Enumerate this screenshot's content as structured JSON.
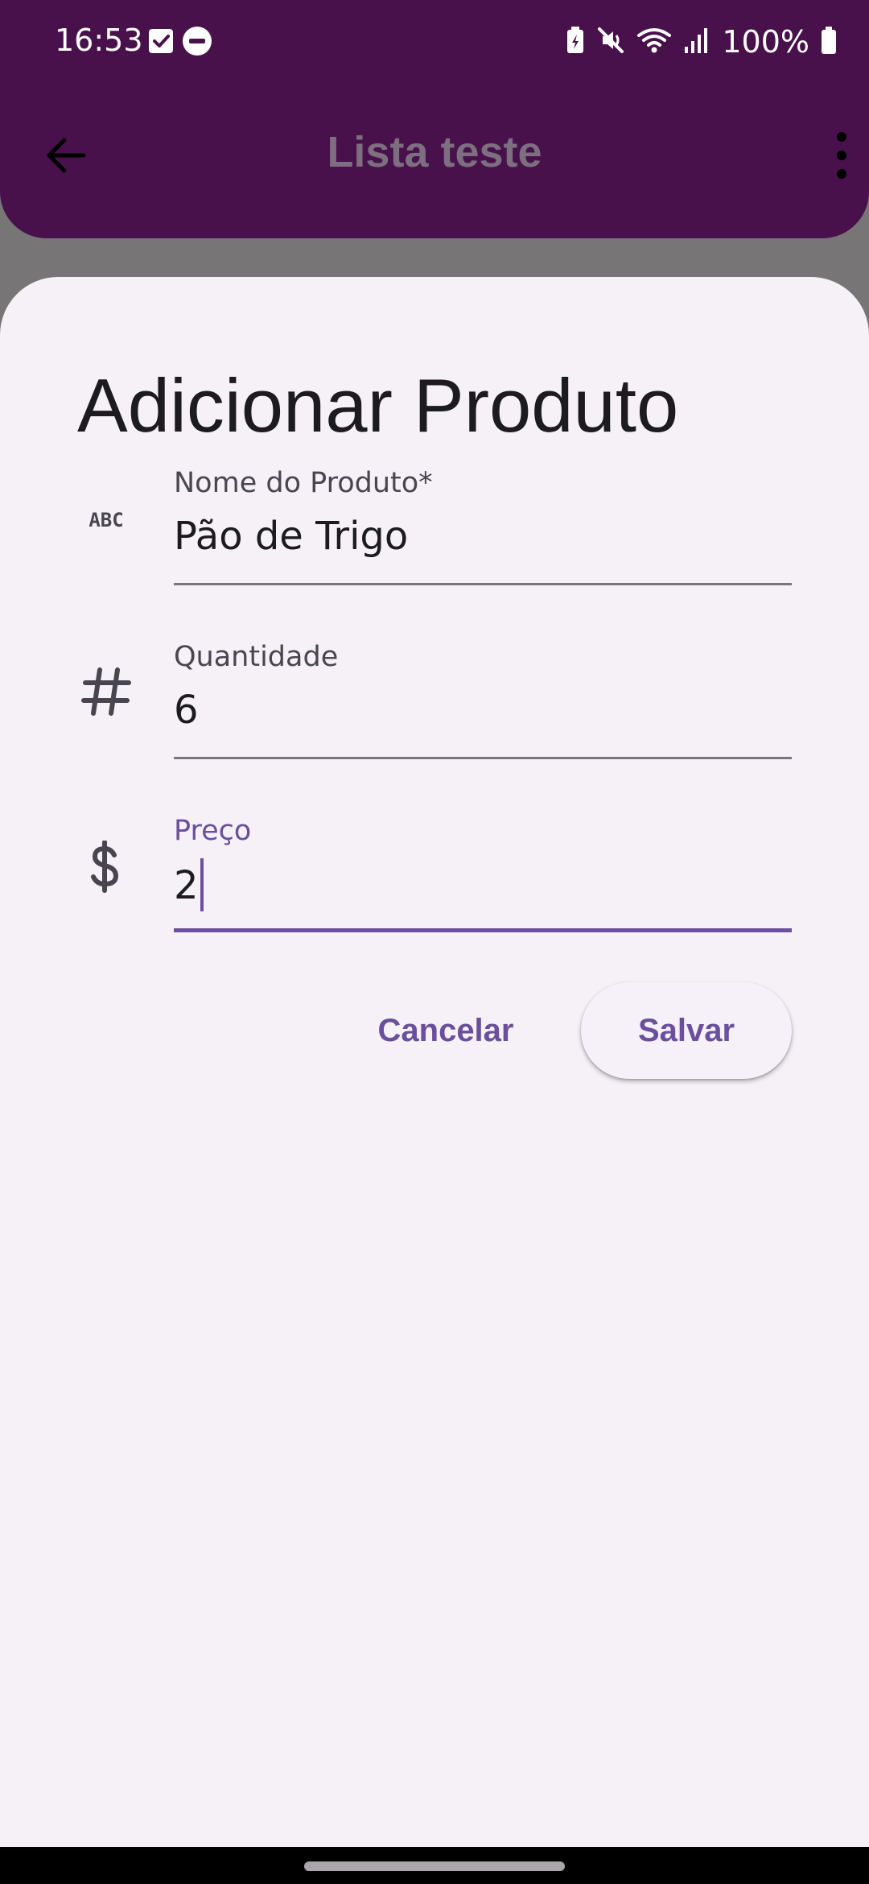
{
  "status_bar": {
    "time": "16:53",
    "left_icons": [
      "checkbox-icon",
      "do-not-disturb-icon"
    ],
    "right_icons": [
      "battery-saver-icon",
      "mute-icon",
      "wifi-icon",
      "signal-icon",
      "battery-icon"
    ],
    "battery_text": "100%"
  },
  "app_bar": {
    "title": "Lista teste",
    "back_icon": "arrow-back-icon",
    "menu_icon": "more-vert-icon",
    "color": "#48114c"
  },
  "dialog": {
    "title": "Adicionar Produto",
    "fields": {
      "name": {
        "label": "Nome do Produto*",
        "value": "Pão de Trigo",
        "icon": "abc-icon"
      },
      "quantity": {
        "label": "Quantidade",
        "value": "6",
        "icon": "hash-icon"
      },
      "price": {
        "label": "Preço",
        "value": "2",
        "icon": "dollar-icon",
        "focused": true
      }
    },
    "buttons": {
      "cancel": "Cancelar",
      "save": "Salvar"
    },
    "accent": "#6a4f9e"
  }
}
